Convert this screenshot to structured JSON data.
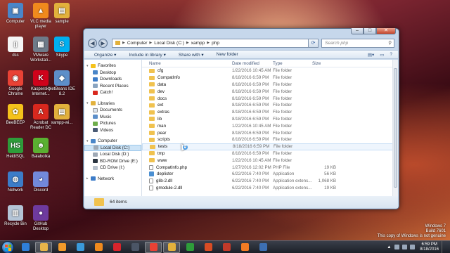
{
  "desktop_icons": [
    {
      "label": "Computer",
      "color": "#4a86c8",
      "glyph": "▣"
    },
    {
      "label": "VLC media player",
      "color": "#f08a1d",
      "glyph": "▲"
    },
    {
      "label": "sample",
      "color": "#e2b13c",
      "glyph": "▤"
    },
    {
      "label": "dss",
      "color": "#f4f4f4",
      "glyph": "▯"
    },
    {
      "label": "VMware Workstati...",
      "color": "#6e7b89",
      "glyph": "▦"
    },
    {
      "label": "Skype",
      "color": "#00aff0",
      "glyph": "S"
    },
    {
      "label": "Google Chrome",
      "color": "#e94235",
      "glyph": "◉"
    },
    {
      "label": "Kaspersky Internet...",
      "color": "#d0021b",
      "glyph": "K"
    },
    {
      "label": "NetBeans IDE 8.2",
      "color": "#5d8fc9",
      "glyph": "◆"
    },
    {
      "label": "BeeBEEP",
      "color": "#f5c21b",
      "glyph": "✿"
    },
    {
      "label": "Acrobat Reader DC",
      "color": "#d8281e",
      "glyph": "A"
    },
    {
      "label": "xampp-wi...",
      "color": "#e2b13c",
      "glyph": "▤"
    },
    {
      "label": "HeidiSQL",
      "color": "#2e9c3a",
      "glyph": "HS"
    },
    {
      "label": "Balabolka",
      "color": "#5ab031",
      "glyph": "☻"
    },
    {
      "label": "Network",
      "color": "#3c7cc8",
      "glyph": "◍"
    },
    {
      "label": "Discord",
      "color": "#7289da",
      "glyph": "◕"
    },
    {
      "label": "Recycle Bin",
      "color": "#b4c4d6",
      "glyph": "▥"
    },
    {
      "label": "GitHub Desktop",
      "color": "#6e3a9e",
      "glyph": "●"
    }
  ],
  "window": {
    "controls": {
      "minimize": "–",
      "maximize": "□",
      "close": "✕"
    },
    "address": {
      "segments": [
        "Computer",
        "Local Disk (C:)",
        "xampp",
        "php"
      ]
    },
    "search_placeholder": "Search php",
    "toolbar": {
      "organize": "Organize ▾",
      "include": "Include in library ▾",
      "share": "Share with ▾",
      "new_folder": "New folder"
    },
    "nav": {
      "favorites": {
        "label": "Favorites",
        "items": [
          "Desktop",
          "Downloads",
          "Recent Places",
          "Catch!"
        ]
      },
      "libraries": {
        "label": "Libraries",
        "items": [
          "Documents",
          "Music",
          "Pictures",
          "Videos"
        ]
      },
      "computer": {
        "label": "Computer",
        "items": [
          "Local Disk (C:)",
          "Local Disk (D:)",
          "BD-ROM Drive (E:)",
          "CD Drive (I:)"
        ]
      },
      "network": {
        "label": "Network"
      }
    },
    "columns": {
      "name": "Name",
      "date": "Date modified",
      "type": "Type",
      "size": "Size"
    },
    "files": [
      {
        "name": "cfg",
        "date": "1/22/2016 10:45 AM",
        "type": "File folder",
        "size": "",
        "kind": "folder"
      },
      {
        "name": "CompatInfo",
        "date": "8/18/2016 6:59 PM",
        "type": "File folder",
        "size": "",
        "kind": "folder"
      },
      {
        "name": "data",
        "date": "8/18/2016 6:59 PM",
        "type": "File folder",
        "size": "",
        "kind": "folder"
      },
      {
        "name": "dev",
        "date": "8/18/2016 6:59 PM",
        "type": "File folder",
        "size": "",
        "kind": "folder"
      },
      {
        "name": "docs",
        "date": "8/18/2016 6:59 PM",
        "type": "File folder",
        "size": "",
        "kind": "folder"
      },
      {
        "name": "ext",
        "date": "8/18/2016 6:59 PM",
        "type": "File folder",
        "size": "",
        "kind": "folder"
      },
      {
        "name": "extras",
        "date": "8/18/2016 6:59 PM",
        "type": "File folder",
        "size": "",
        "kind": "folder"
      },
      {
        "name": "lib",
        "date": "8/18/2016 6:59 PM",
        "type": "File folder",
        "size": "",
        "kind": "folder"
      },
      {
        "name": "man",
        "date": "1/22/2016 10:45 AM",
        "type": "File folder",
        "size": "",
        "kind": "folder"
      },
      {
        "name": "pear",
        "date": "8/18/2016 6:59 PM",
        "type": "File folder",
        "size": "",
        "kind": "folder"
      },
      {
        "name": "scripts",
        "date": "8/18/2016 6:59 PM",
        "type": "File folder",
        "size": "",
        "kind": "folder"
      },
      {
        "name": "tests",
        "date": "8/18/2016 6:59 PM",
        "type": "File folder",
        "size": "",
        "kind": "folder"
      },
      {
        "name": "tmp",
        "date": "8/18/2016 6:59 PM",
        "type": "File folder",
        "size": "",
        "kind": "folder"
      },
      {
        "name": "www",
        "date": "1/22/2016 10:45 AM",
        "type": "File folder",
        "size": "",
        "kind": "folder"
      },
      {
        "name": "CompatInfo.php",
        "date": "1/27/2016 12:02 PM",
        "type": "PHP File",
        "size": "19 KB",
        "kind": "file"
      },
      {
        "name": "deplister",
        "date": "6/22/2016 7:40 PM",
        "type": "Application",
        "size": "56 KB",
        "kind": "app"
      },
      {
        "name": "glib-2.dll",
        "date": "6/22/2016 7:40 PM",
        "type": "Application extens...",
        "size": "1,068 KB",
        "kind": "file"
      },
      {
        "name": "gmodule-2.dll",
        "date": "6/22/2016 7:40 PM",
        "type": "Application extens...",
        "size": "19 KB",
        "kind": "file"
      }
    ],
    "status": "64 items"
  },
  "taskbar": {
    "apps": [
      {
        "name": "ie",
        "color": "#2f7fd8"
      },
      {
        "name": "explorer",
        "color": "#e8b54a"
      },
      {
        "name": "media",
        "color": "#f19a2a"
      },
      {
        "name": "screen",
        "color": "#3a9ad9"
      },
      {
        "name": "vlc",
        "color": "#f08a1d"
      },
      {
        "name": "opera",
        "color": "#d8242c"
      },
      {
        "name": "fox",
        "color": "#4b5566"
      },
      {
        "name": "chrome",
        "color": "#e94235"
      },
      {
        "name": "folder",
        "color": "#e2b13c"
      },
      {
        "name": "camtasia",
        "color": "#2e9c3a"
      },
      {
        "name": "app-c",
        "color": "#d84c24"
      },
      {
        "name": "app-c2",
        "color": "#c23a2a"
      },
      {
        "name": "xampp",
        "color": "#f27b23"
      },
      {
        "name": "app",
        "color": "#3d6fb2"
      }
    ],
    "time": "6:59 PM",
    "date": "8/18/2016"
  },
  "watermark": {
    "line1": "Windows 7",
    "line2": "Build 7601",
    "line3": "This copy of Windows is not genuine"
  }
}
